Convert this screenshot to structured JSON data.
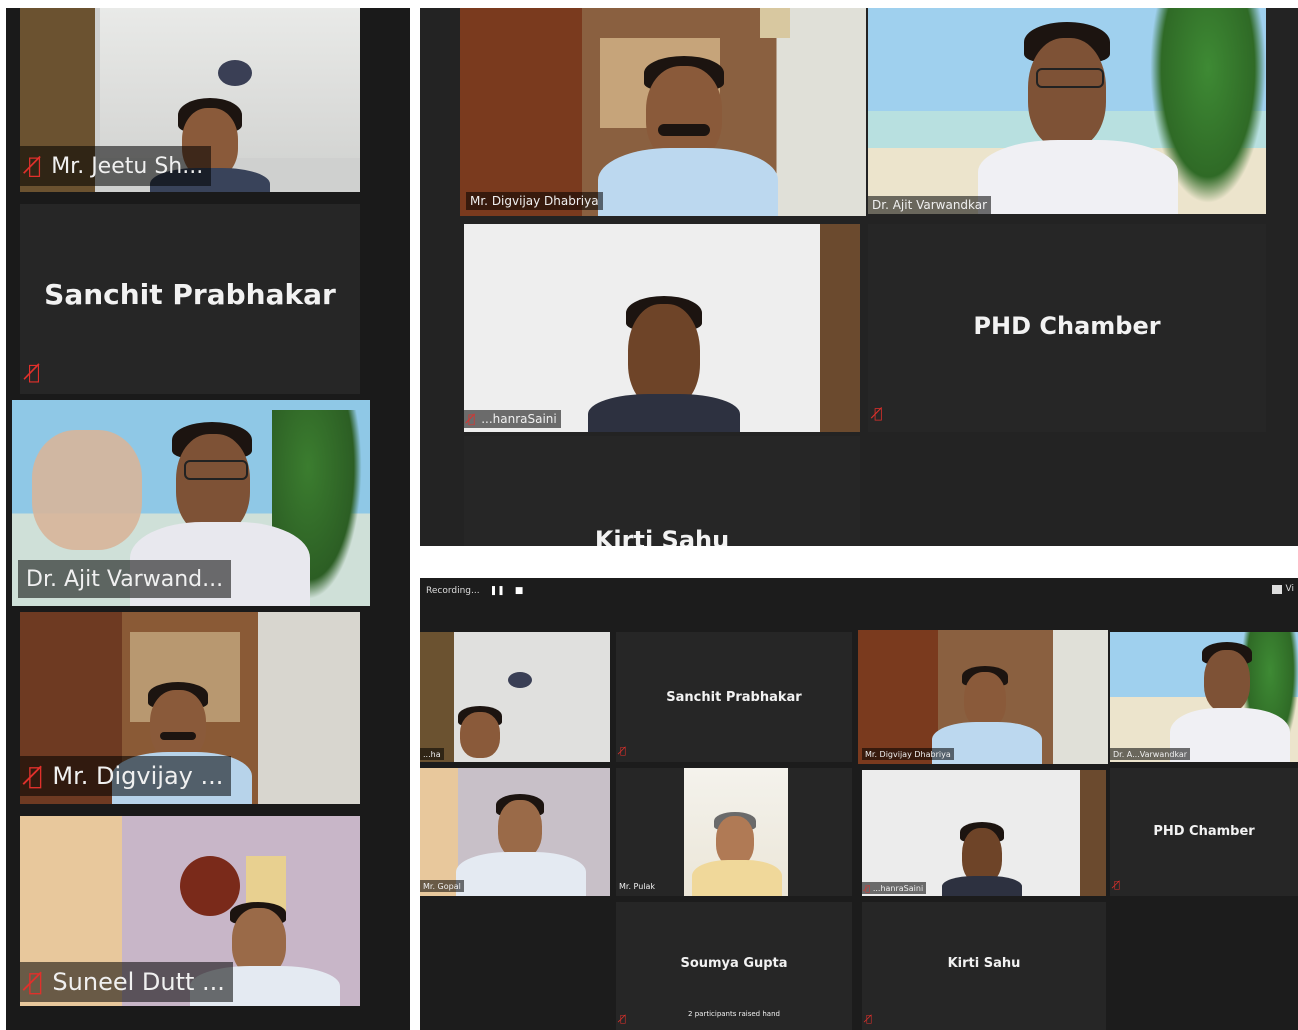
{
  "colors": {
    "active_border": "#e9e36b",
    "tile_bg": "#262626",
    "panel_bg": "#1a1a1a",
    "muted_red": "#e0302b"
  },
  "left_strip": {
    "tiles": [
      {
        "label": "Mr. Jeetu Sh..."
      },
      {
        "name": "Sanchit Prabhakar"
      },
      {
        "label": "Dr. Ajit Varwand..."
      },
      {
        "label": "Mr. Digvijay ..."
      },
      {
        "label": "Suneel Dutt ..."
      }
    ]
  },
  "top_right": {
    "tiles": [
      {
        "label": "Mr. Digvijay Dhabriya"
      },
      {
        "label": "Dr. Ajit Varwandkar"
      },
      {
        "label": "...hanraSaini"
      },
      {
        "name": "PHD Chamber"
      },
      {
        "name": "Kirti Sahu"
      }
    ]
  },
  "bottom_right": {
    "recording_label": "Recording...",
    "view_label": "Vi",
    "tiles": [
      {
        "label": "...ha"
      },
      {
        "name": "Sanchit Prabhakar"
      },
      {
        "label": "Mr. Digvijay Dhabriya"
      },
      {
        "label": "Dr. A...Varwandkar"
      },
      {
        "label": "Mr. Gopal"
      },
      {
        "label": "Mr. Pulak"
      },
      {
        "label": "...hanraSaini"
      },
      {
        "name": "PHD Chamber"
      },
      {
        "name": "Soumya Gupta",
        "sub": "2 participants raised hand"
      },
      {
        "name": "Kirti Sahu"
      }
    ]
  },
  "icons": {
    "mute": "muted-mic-icon",
    "stop": "stop-icon",
    "pause": "pause-icon",
    "view": "gallery-view-icon"
  }
}
